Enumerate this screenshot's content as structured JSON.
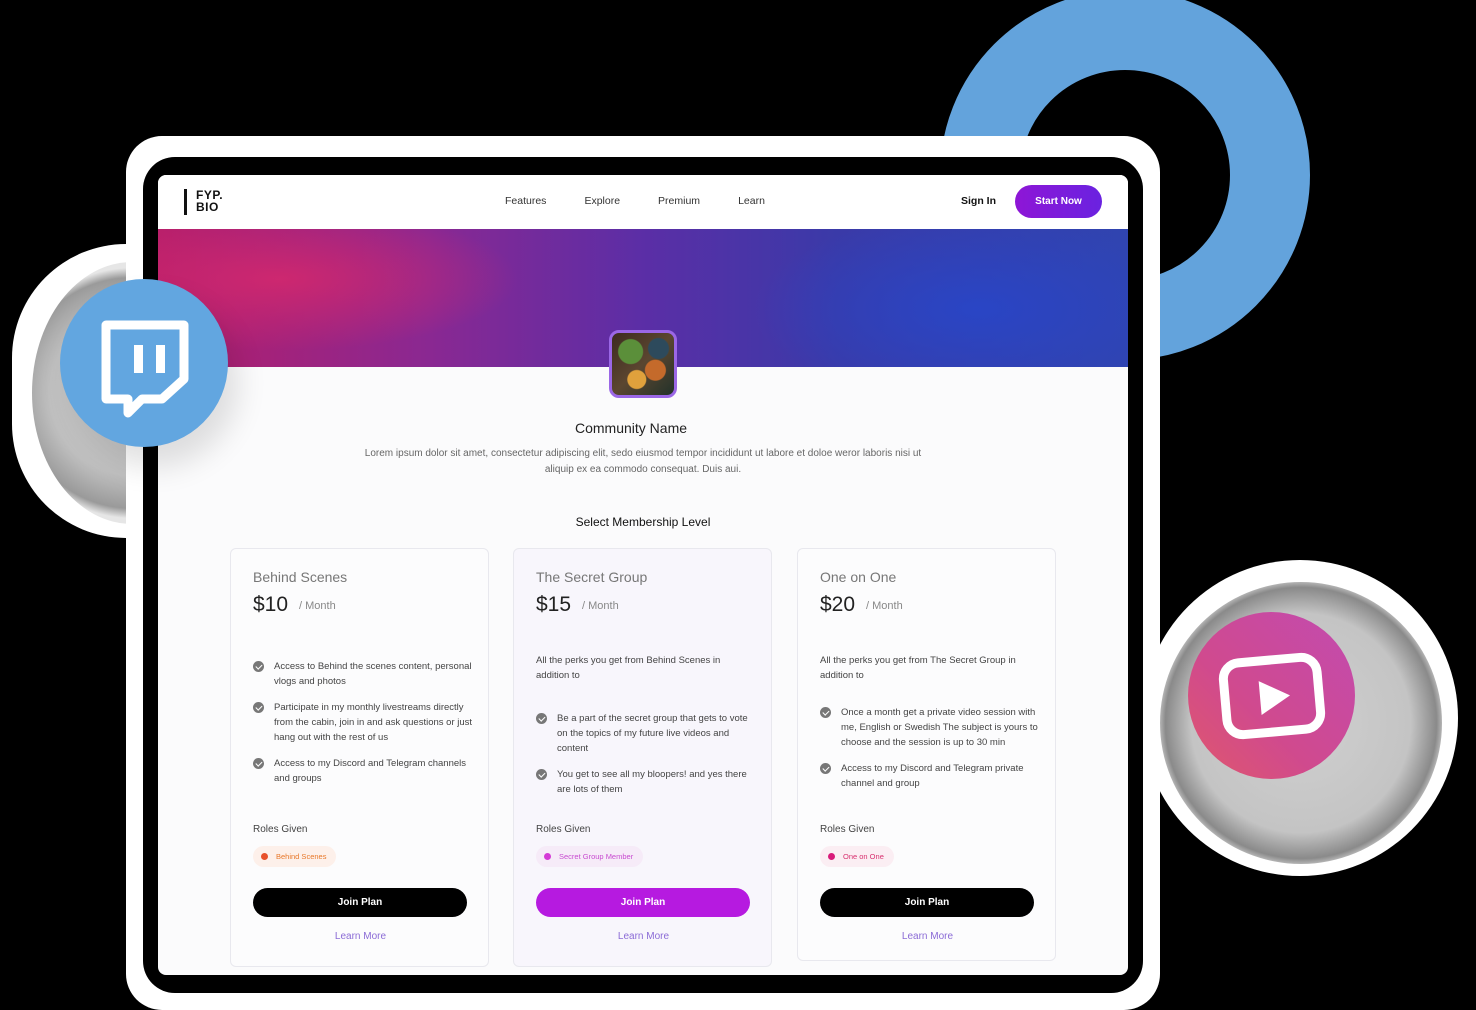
{
  "nav": {
    "logo_line1": "FYP.",
    "logo_line2": "BIO",
    "links": [
      "Features",
      "Explore",
      "Premium",
      "Learn"
    ],
    "sign_in": "Sign In",
    "start_now": "Start Now"
  },
  "community": {
    "name": "Community Name",
    "description": "Lorem ipsum dolor sit amet, consectetur adipiscing elit, sedo eiusmod tempor incididunt ut labore et doloe weror laboris nisi ut aliquip ex ea commodo consequat. Duis aui."
  },
  "membership": {
    "title": "Select Membership Level",
    "plans": [
      {
        "name": "Behind Scenes",
        "price": "$10",
        "period": "/ Month",
        "intro": "",
        "perks": [
          "Access to Behind the scenes content, personal vlogs and photos",
          "Participate in my monthly livestreams directly from the cabin, join in and ask questions or just hang out with the rest of us",
          "Access to my Discord and Telegram channels and groups"
        ],
        "roles_label": "Roles Given",
        "role": "Behind Scenes",
        "role_color": "#e8502a",
        "role_text_color": "#e8782a",
        "role_bg": "#fdf0ea",
        "join": "Join Plan",
        "learn_more": "Learn More"
      },
      {
        "name": "The Secret Group",
        "price": "$15",
        "period": "/ Month",
        "intro": "All the perks you get from Behind Scenes in addition to",
        "perks": [
          "Be a part of the secret group that gets to vote on the topics of my future live videos and content",
          "You get to see all my bloopers! and yes there are lots of them"
        ],
        "roles_label": "Roles Given",
        "role": "Secret Group Member",
        "role_color": "#d43ad6",
        "role_text_color": "#c84bd0",
        "role_bg": "#f6ebf8",
        "join": "Join Plan",
        "learn_more": "Learn More"
      },
      {
        "name": "One on One",
        "price": "$20",
        "period": "/ Month",
        "intro": "All the perks you get from The Secret Group in addition to",
        "perks": [
          "Once a month get a private video session with me, English or Swedish The subject is yours to choose and the session is up to 30 min",
          "Access to my Discord and Telegram private channel and group"
        ],
        "roles_label": "Roles Given",
        "role": "One on One",
        "role_color": "#d81b7a",
        "role_text_color": "#d8306f",
        "role_bg": "#fbeef3",
        "join": "Join Plan",
        "learn_more": "Learn More"
      }
    ]
  },
  "icons": {
    "twitch": "twitch-icon",
    "youtube": "youtube-icon"
  },
  "colors": {
    "accent": "#8e16d6",
    "featured_button": "#b61ae0",
    "learn_more": "#8b6bd6",
    "twitch_bubble": "#62a6e0",
    "deco_ring": "#63a3dc"
  }
}
